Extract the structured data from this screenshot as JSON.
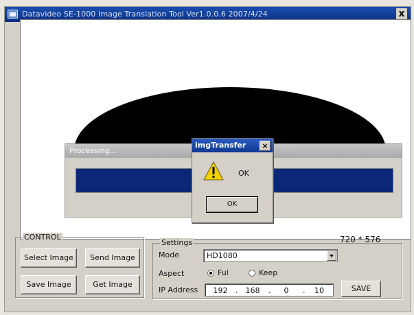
{
  "window": {
    "title": "Datavideo SE-1000 Image Translation Tool Ver1.0.0.6 2007/4/24",
    "close_glyph": "x"
  },
  "processing": {
    "title": "Processing...",
    "progress": 1.0
  },
  "dialog": {
    "title": "imgTransfer",
    "close_glyph": "×",
    "message": "OK",
    "ok_label": "OK",
    "icon": "warning-icon"
  },
  "resolution": "720 * 576",
  "control": {
    "legend": "CONTROL",
    "select_image": "Select Image",
    "send_image": "Send Image",
    "save_image": "Save Image",
    "get_image": "Get Image"
  },
  "settings": {
    "legend": "Settings",
    "mode_label": "Mode",
    "mode_value": "HD1080",
    "aspect_label": "Aspect",
    "aspect_full": "Ful",
    "aspect_keep": "Keep",
    "aspect_selected": "Ful",
    "ip_label": "IP Address",
    "ip": [
      "192",
      "168",
      "0",
      "10"
    ],
    "ip_dot": ".",
    "save_label": "SAVE"
  },
  "colors": {
    "titlebar": "#1a4fb0",
    "progress_fill": "#0c2777",
    "image_shape": "#000000"
  }
}
